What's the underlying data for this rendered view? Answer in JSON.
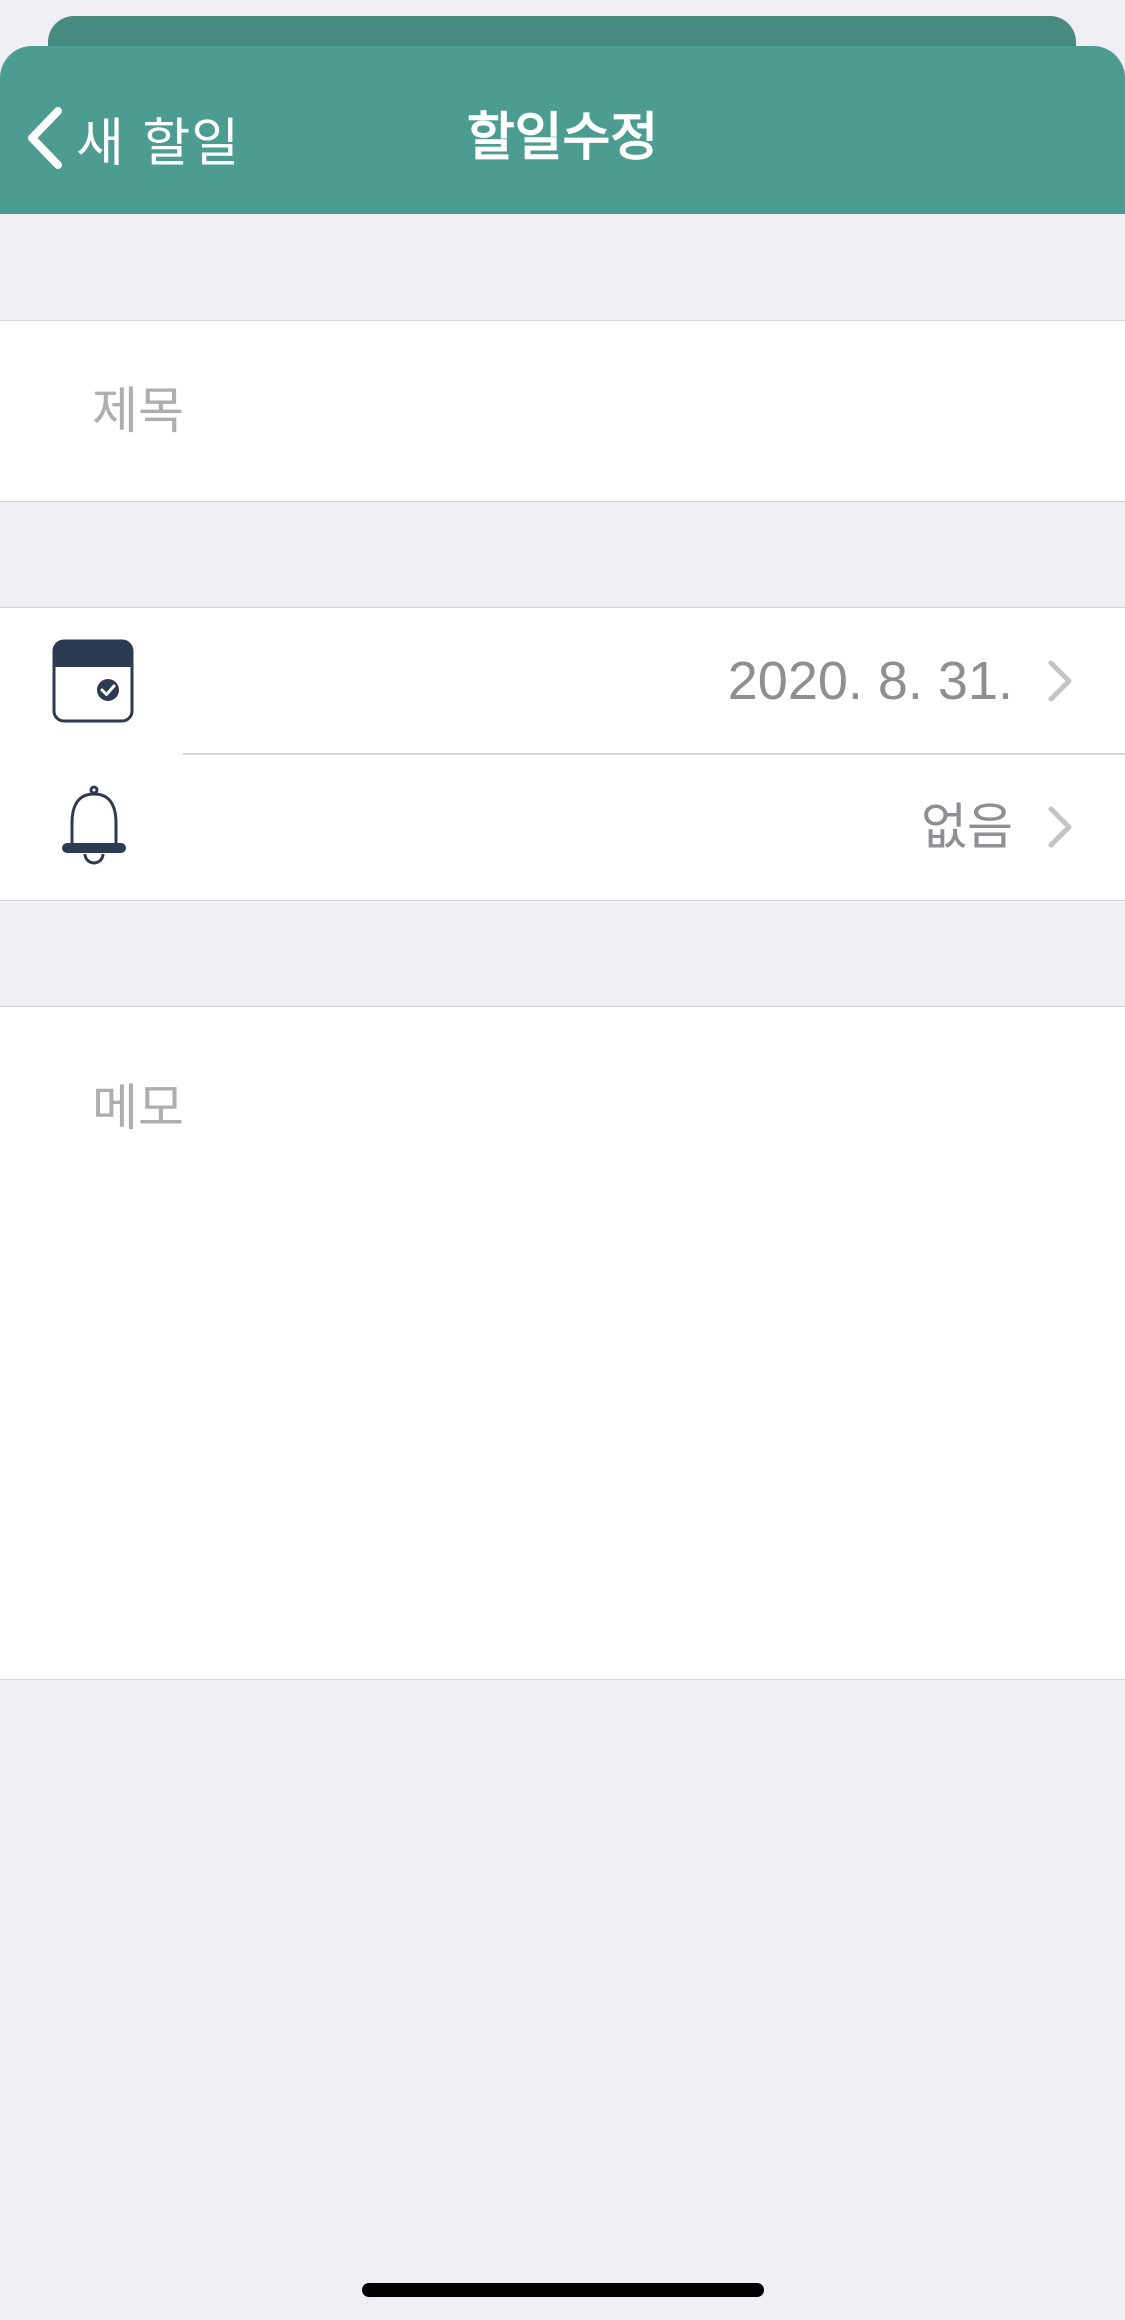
{
  "header": {
    "back_label": "새 할일",
    "title": "할일수정"
  },
  "form": {
    "title_placeholder": "제목",
    "date_value": "2020. 8. 31.",
    "alarm_value": "없음",
    "memo_placeholder": "메모"
  },
  "icons": {
    "back": "chevron-left-icon",
    "date": "calendar-check-icon",
    "alarm": "bell-icon",
    "disclosure": "chevron-right-icon"
  },
  "colors": {
    "header": "#4c9c92",
    "header_behind": "#478a80",
    "background": "#f0eff5",
    "icon_dark": "#2c3a52",
    "secondary_text": "#8e8e93",
    "placeholder": "#aeaeb2"
  }
}
